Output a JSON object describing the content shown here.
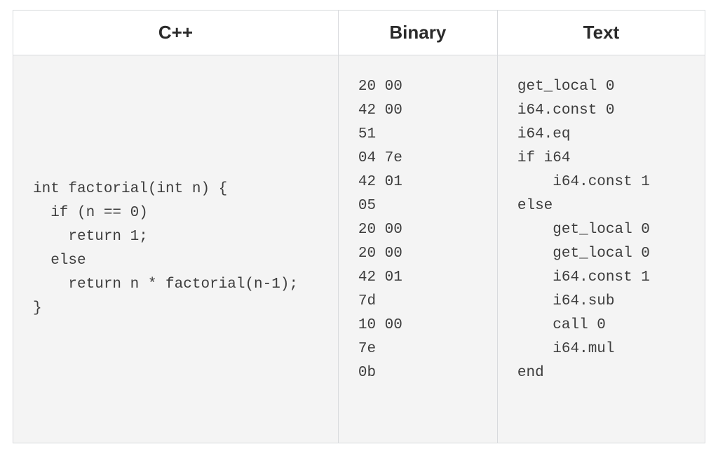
{
  "table": {
    "headers": {
      "cpp": "C++",
      "binary": "Binary",
      "text": "Text"
    },
    "cells": {
      "cpp": "int factorial(int n) {\n  if (n == 0)\n    return 1;\n  else\n    return n * factorial(n-1);\n}",
      "binary": "20 00\n42 00\n51\n04 7e\n42 01\n05\n20 00\n20 00\n42 01\n7d\n10 00\n7e\n0b",
      "text": "get_local 0\ni64.const 0\ni64.eq\nif i64\n    i64.const 1\nelse\n    get_local 0\n    get_local 0\n    i64.const 1\n    i64.sub\n    call 0\n    i64.mul\nend"
    }
  }
}
